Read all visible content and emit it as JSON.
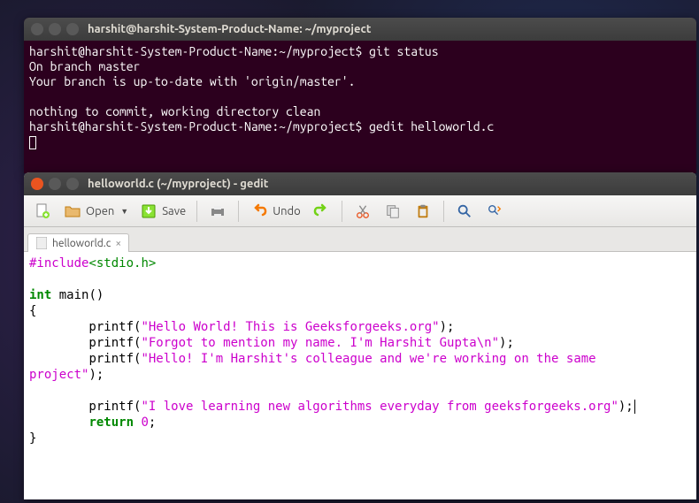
{
  "terminal": {
    "title": "harshit@harshit-System-Product-Name: ~/myproject",
    "lines": {
      "l1_prompt": "harshit@harshit-System-Product-Name:~/myproject$",
      "l1_cmd": " git status",
      "l2": "On branch master",
      "l3": "Your branch is up-to-date with 'origin/master'.",
      "l4": "",
      "l5": "nothing to commit, working directory clean",
      "l6_prompt": "harshit@harshit-System-Product-Name:~/myproject$",
      "l6_cmd": " gedit helloworld.c"
    }
  },
  "gedit": {
    "title": "helloworld.c (~/myproject) - gedit",
    "toolbar": {
      "open": "Open",
      "save": "Save",
      "undo": "Undo"
    },
    "tab_name": "helloworld.c",
    "code": {
      "l1_a": "#include",
      "l1_b": "<stdio.h>",
      "l2": "",
      "l3_kw": "int",
      "l3_rest": " main()",
      "l4": "{",
      "l5_indent": "        printf(",
      "l5_str": "\"Hello World! This is Geeksforgeeks.org\"",
      "l5_end": ");",
      "l6_indent": "        printf(",
      "l6_str_a": "\"Forgot to mention my name. I'm Harshit Gupta",
      "l6_esc": "\\n",
      "l6_str_b": "\"",
      "l6_end": ");",
      "l7_indent": "        printf(",
      "l7_str_a": "\"Hello! I'm Harshit's colleague and we're working on the same ",
      "l7b_str": "project\"",
      "l7b_end": ");",
      "l8": "",
      "l9_indent": "        printf(",
      "l9_str": "\"I love learning new algorithms everyday from geeksforgeeks.org\"",
      "l9_end": ");",
      "l10_indent": "        ",
      "l10_kw": "return",
      "l10_sp": " ",
      "l10_num": "0",
      "l10_end": ";",
      "l11": "}"
    }
  }
}
